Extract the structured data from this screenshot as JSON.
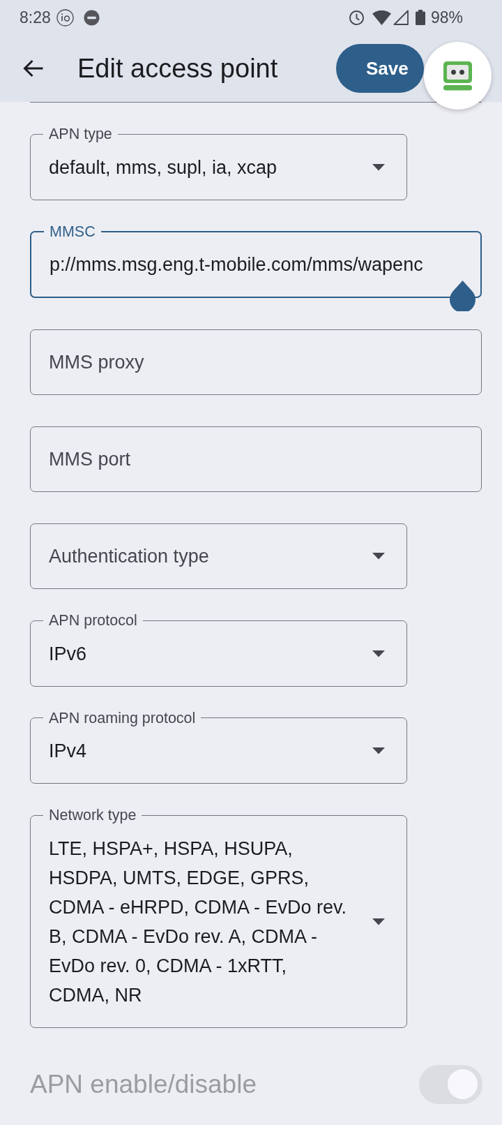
{
  "status_bar": {
    "time": "8:28",
    "battery": "98%"
  },
  "app_bar": {
    "title": "Edit access point",
    "save_button": "Save"
  },
  "fields": [
    {
      "kind": "dropdown",
      "label": "APN type",
      "value": "default, mms, supl, ia, xcap",
      "focused": false
    },
    {
      "kind": "text",
      "label": "MMSC",
      "value": "p://mms.msg.eng.t-mobile.com/mms/wapenc",
      "focused": true
    },
    {
      "kind": "text",
      "placeholder": "MMS proxy",
      "focused": false
    },
    {
      "kind": "text",
      "placeholder": "MMS port",
      "focused": false
    },
    {
      "kind": "dropdown",
      "placeholder": "Authentication type",
      "focused": false
    },
    {
      "kind": "dropdown",
      "label": "APN protocol",
      "value": "IPv6",
      "focused": false
    },
    {
      "kind": "dropdown",
      "label": "APN roaming protocol",
      "value": "IPv4",
      "focused": false
    },
    {
      "kind": "dropdown",
      "label": "Network type",
      "value": "LTE, HSPA+, HSPA, HSUPA, HSDPA, UMTS, EDGE, GPRS, CDMA - eHRPD, CDMA - EvDo rev. B, CDMA - EvDo rev. A, CDMA - EvDo rev. 0, CDMA - 1xRTT, CDMA, NR",
      "focused": false
    }
  ],
  "toggle": {
    "label": "APN enable/disable",
    "on": true,
    "disabled": true
  }
}
